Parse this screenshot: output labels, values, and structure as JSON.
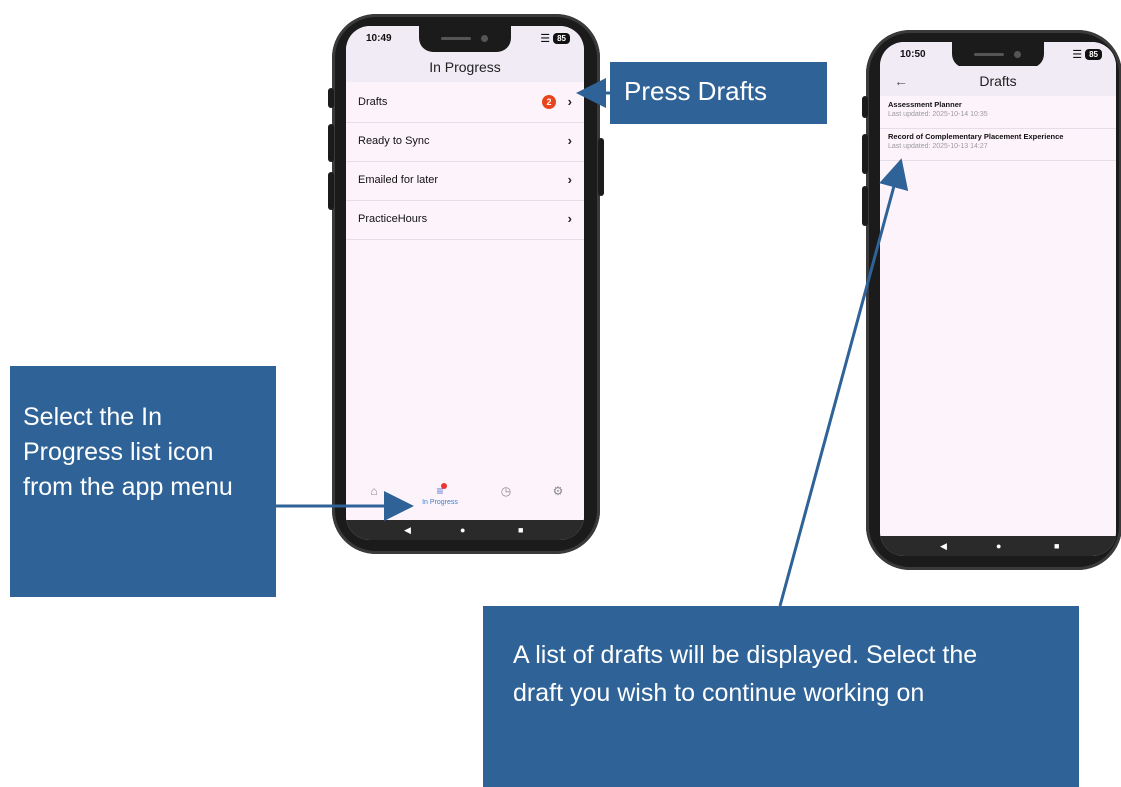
{
  "colors": {
    "callout_bg": "#2f6398",
    "arrow": "#2f6398",
    "badge": "#e8451c",
    "nav_active": "#3a7fc7"
  },
  "phone1": {
    "status_time": "10:49",
    "battery": "85",
    "title": "In Progress",
    "rows": [
      {
        "label": "Drafts",
        "badge": "2"
      },
      {
        "label": "Ready to Sync"
      },
      {
        "label": "Emailed for later"
      },
      {
        "label": "PracticeHours"
      }
    ],
    "bottom_nav": {
      "items": [
        {
          "icon": "home-icon"
        },
        {
          "icon": "in-progress-list-icon",
          "label": "In Progress",
          "active": true
        },
        {
          "icon": "clock-icon"
        },
        {
          "icon": "gear-icon"
        }
      ]
    }
  },
  "phone2": {
    "status_time": "10:50",
    "battery": "85",
    "title": "Drafts",
    "drafts": [
      {
        "title": "Assessment Planner",
        "updated": "Last updated: 2025-10-14 10:35"
      },
      {
        "title": "Record of Complementary Placement Experience",
        "updated": "Last updated: 2025-10-13 14:27"
      }
    ]
  },
  "callouts": {
    "press_drafts": "Press Drafts",
    "select_in_progress": "Select the In Progress list icon from the app menu",
    "list_of_drafts": "A list of drafts will be displayed. Select the draft you wish to continue working on"
  }
}
